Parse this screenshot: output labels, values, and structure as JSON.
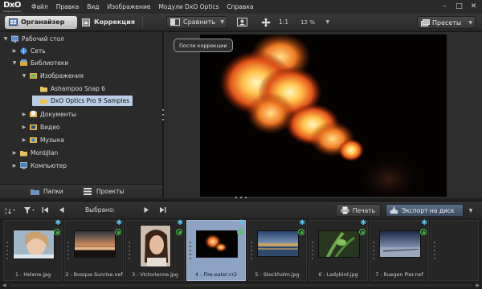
{
  "app": {
    "logo_text": "DxO",
    "logo_sub": "Image Science",
    "menu": [
      "Файл",
      "Правка",
      "Вид",
      "Изображение",
      "Модули DxO Optics",
      "Справка"
    ],
    "window_controls": [
      "–",
      "□",
      "✕"
    ]
  },
  "toolbar": {
    "organizer_label": "Органайзер",
    "correction_label": "Коррекция",
    "compare_label": "Сравнить",
    "zoom_1to1": "1:1",
    "zoom_value": "12 %",
    "presets_label": "Пресеты"
  },
  "tree": [
    {
      "label": "Рабочий стол",
      "expanded": true,
      "icon": "desktop-icon",
      "selected": false
    },
    {
      "label": "Сеть",
      "expanded": false,
      "icon": "network-icon",
      "selected": false
    },
    {
      "label": "Библиотеки",
      "expanded": true,
      "icon": "libraries-icon",
      "selected": false
    },
    {
      "label": "Изображения",
      "expanded": true,
      "icon": "pictures-icon",
      "selected": false
    },
    {
      "label": "Ashampoo Snap 6",
      "expanded": null,
      "icon": "folder-icon",
      "selected": false
    },
    {
      "label": "DxO Optics Pro 9 Samples",
      "expanded": null,
      "icon": "folder-icon",
      "selected": true
    },
    {
      "label": "Документы",
      "expanded": false,
      "icon": "documents-icon",
      "selected": false
    },
    {
      "label": "Видео",
      "expanded": false,
      "icon": "video-icon",
      "selected": false
    },
    {
      "label": "Музыка",
      "expanded": false,
      "icon": "music-icon",
      "selected": false
    },
    {
      "label": "MonbJlan",
      "expanded": false,
      "icon": "folder-icon",
      "selected": false
    },
    {
      "label": "Компьютер",
      "expanded": false,
      "icon": "computer-icon",
      "selected": false
    }
  ],
  "left_tabs": {
    "folders_label": "Папки",
    "projects_label": "Проекты"
  },
  "viewer": {
    "tag": "После коррекции"
  },
  "filmstrip_toolbar": {
    "selected_label": "Выбрано:",
    "print_label": "Печать",
    "export_label": "Экспорт на диск"
  },
  "thumbnails": [
    {
      "caption": "1 - Helene.jpg",
      "selected": false,
      "orientation": "landscape",
      "subject": "portrait-woman"
    },
    {
      "caption": "2 - Bosque Sunrise.nef",
      "selected": false,
      "orientation": "landscape",
      "subject": "sunrise"
    },
    {
      "caption": "3 - Victorienne.jpg",
      "selected": false,
      "orientation": "portrait",
      "subject": "portrait-woman-dark"
    },
    {
      "caption": "4 - Fire-eater.cr2",
      "selected": true,
      "orientation": "landscape",
      "subject": "fire"
    },
    {
      "caption": "5 - Stockholm.jpg",
      "selected": false,
      "orientation": "landscape",
      "subject": "city-water"
    },
    {
      "caption": "6 - Ladybird.jpg",
      "selected": false,
      "orientation": "landscape",
      "subject": "green-plant"
    },
    {
      "caption": "7 - Ruegen Pier.nef",
      "selected": false,
      "orientation": "landscape",
      "subject": "pier-sky"
    }
  ],
  "colors": {
    "accent_selected": "#8da3c4",
    "tree_selected": "#b9cde6",
    "star": "#58c6ee",
    "status_ok": "#46c846",
    "export_button": "#4a5d75"
  }
}
